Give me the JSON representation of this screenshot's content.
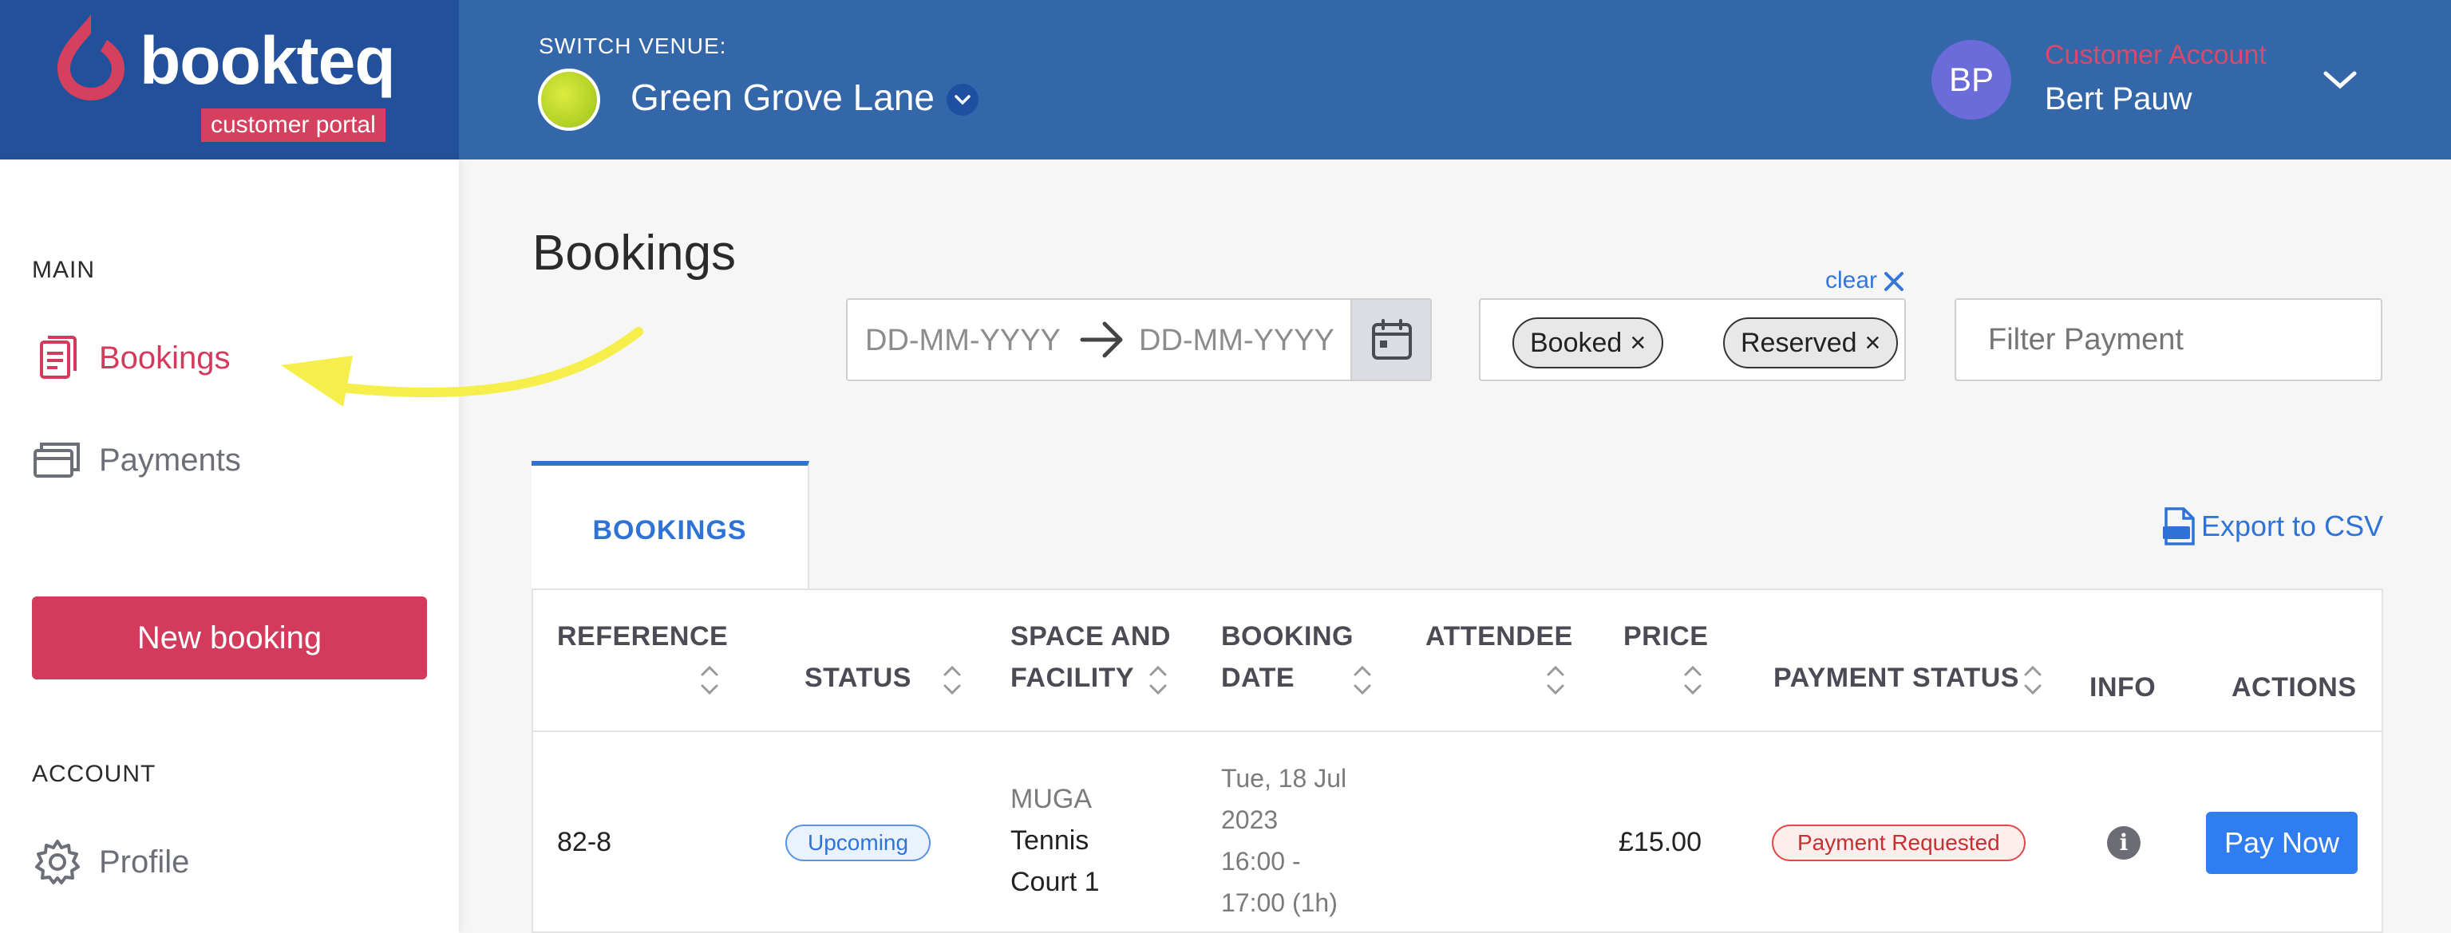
{
  "brand": {
    "name": "bookteq",
    "subtitle": "customer portal",
    "colors": {
      "primary": "#3466aa",
      "logo_bg": "#23509a",
      "accent": "#d33a5b",
      "link": "#2f73d6"
    }
  },
  "header": {
    "switch_label": "SWITCH VENUE:",
    "venue_name": "Green Grove Lane",
    "venue_icon": "tennis-ball-icon",
    "user": {
      "initials": "BP",
      "account_type": "Customer Account",
      "name": "Bert Pauw"
    }
  },
  "sidebar": {
    "main_label": "MAIN",
    "items": [
      {
        "label": "Bookings",
        "icon": "bookings-icon",
        "active": true
      },
      {
        "label": "Payments",
        "icon": "payments-icon",
        "active": false
      }
    ],
    "new_booking_label": "New booking",
    "account_label": "ACCOUNT",
    "account_items": [
      {
        "label": "Profile",
        "icon": "gear-icon"
      }
    ]
  },
  "main": {
    "title": "Bookings",
    "filters": {
      "date_from_placeholder": "DD-MM-YYYY",
      "date_to_placeholder": "DD-MM-YYYY",
      "clear_label": "clear",
      "status_chips": [
        "Booked",
        "Reserved"
      ],
      "payment_placeholder": "Filter Payment"
    },
    "tabs": [
      {
        "label": "BOOKINGS",
        "active": true
      }
    ],
    "export_label": "Export to CSV",
    "table": {
      "headers": {
        "reference": "REFERENCE",
        "status": "STATUS",
        "space_1": "SPACE AND",
        "space_2": "FACILITY",
        "date_1": "BOOKING",
        "date_2": "DATE",
        "attendee": "ATTENDEE",
        "price": "PRICE",
        "payment_status": "PAYMENT STATUS",
        "info": "INFO",
        "actions": "ACTIONS"
      },
      "rows": [
        {
          "reference": "82-8",
          "status": "Upcoming",
          "space": "MUGA",
          "facility_1": "Tennis",
          "facility_2": "Court 1",
          "date_1": "Tue, 18 Jul",
          "date_2": "2023",
          "time_1": "16:00 -",
          "time_2": "17:00 (1h)",
          "attendee": "",
          "price": "£15.00",
          "payment_status": "Payment Requested",
          "action_label": "Pay Now"
        }
      ]
    }
  }
}
